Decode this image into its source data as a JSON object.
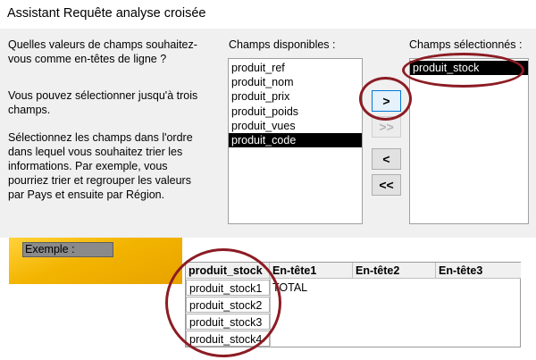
{
  "window": {
    "title": "Assistant Requête analyse croisée"
  },
  "instructions": {
    "question": "Quelles valeurs de champs souhaitez-vous comme en-têtes de ligne ?",
    "limit": "Vous pouvez sélectionner jusqu'à trois champs.",
    "order": "Sélectionnez les champs dans l'ordre dans lequel vous souhaitez trier les informations.  Par exemple, vous pourriez trier et regrouper les valeurs par Pays et ensuite par Région."
  },
  "available": {
    "label": "Champs disponibles :",
    "items": [
      "produit_ref",
      "produit_nom",
      "produit_prix",
      "produit_poids",
      "produit_vues",
      "produit_code"
    ],
    "selected_index": 5
  },
  "selected": {
    "label": "Champs sélectionnés :",
    "items": [
      "produit_stock"
    ]
  },
  "buttons": {
    "add": ">",
    "add_all": ">>",
    "remove": "<",
    "remove_all": "<<"
  },
  "sample": {
    "label": "Exemple :",
    "headers": [
      "produit_stock",
      "En-tête1",
      "En-tête2",
      "En-tête3"
    ],
    "rows": [
      "produit_stock1",
      "produit_stock2",
      "produit_stock3",
      "produit_stock4"
    ],
    "total": "TOTAL"
  },
  "colors": {
    "highlight_ring": "#8c1c24",
    "sample_band": "#f3b400",
    "selection": "#000000"
  }
}
